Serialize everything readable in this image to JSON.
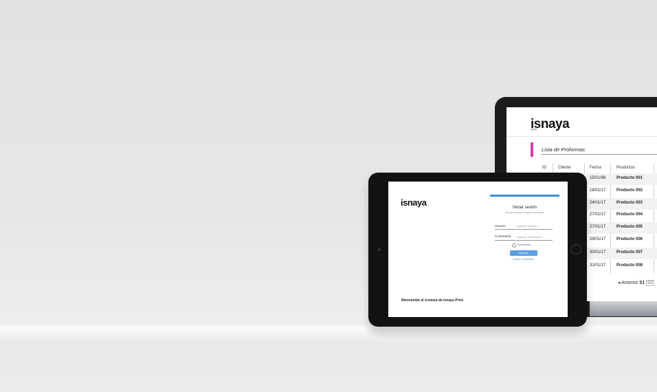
{
  "laptop": {
    "logo": "isnaya",
    "logo_sub": "print",
    "section_title": "Lista de Proformas",
    "columns": [
      "ID",
      "Cliente",
      "Fecha",
      "Productos"
    ],
    "rows": [
      {
        "fecha": "15/01/98",
        "producto": "Producto 001"
      },
      {
        "fecha": "18/01/17",
        "producto": "Producto 002"
      },
      {
        "fecha": "24/01/17",
        "producto": "Producto 003"
      },
      {
        "fecha": "27/01/17",
        "producto": "Producto 004"
      },
      {
        "fecha": "27/01/17",
        "producto": "Producto 005"
      },
      {
        "fecha": "29/01/17",
        "producto": "Producto 006"
      },
      {
        "fecha": "30/01/17",
        "producto": "Producto 007"
      },
      {
        "fecha": "31/01/17",
        "producto": "Producto 008"
      }
    ],
    "pagination": {
      "prev": "◂ Anterior",
      "page1": "01",
      "page2": "02"
    }
  },
  "tablet": {
    "logo": "isnaya",
    "login": {
      "title": "Iniciar sesión",
      "subtitle": "Por favor ingrese su usuario y contraseña",
      "user_label": "Usuario",
      "user_placeholder": "Ingresar usuario...",
      "pass_label": "Contraseña",
      "pass_placeholder": "Ingresar contraseña...",
      "remember": "Recordarme",
      "submit": "Ingresar",
      "forgot": "¿Olvidó contraseña?"
    },
    "welcome": "Bienvenido al sistema de Isnaya Print."
  },
  "colors": {
    "accent_magenta": "#d63fb0",
    "accent_blue": "#3b8fd9",
    "device_black": "#121212"
  }
}
